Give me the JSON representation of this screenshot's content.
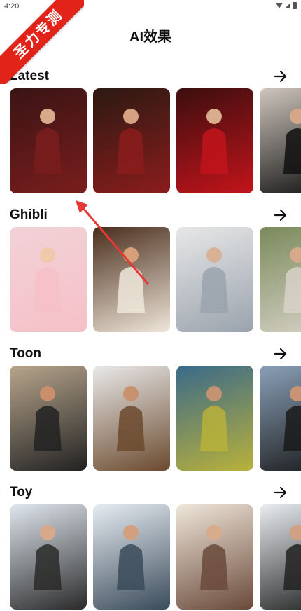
{
  "status": {
    "time": "4:20"
  },
  "badge": {
    "text": "圣力专测"
  },
  "page": {
    "title": "AI效果"
  },
  "sections": [
    {
      "label": "Latest",
      "cards": [
        {
          "bg": "#3a1414",
          "accent": "#7a1d1d",
          "skin": "#d8a98a"
        },
        {
          "bg": "#2c1a12",
          "accent": "#8b1c1c",
          "skin": "#d4a283"
        },
        {
          "bg": "#3c0e0e",
          "accent": "#c2141b",
          "skin": "#d9ae8e"
        },
        {
          "bg": "#cfc6bd",
          "accent": "#111111",
          "skin": "#d6a688"
        }
      ]
    },
    {
      "label": "Ghibli",
      "cards": [
        {
          "bg": "#f1d2d6",
          "accent": "#f6c0c8",
          "skin": "#f0c8aa"
        },
        {
          "bg": "#4a2e1c",
          "accent": "#efe6da",
          "skin": "#d7a07a"
        },
        {
          "bg": "#e7e7e7",
          "accent": "#9aa3ad",
          "skin": "#d9b197"
        },
        {
          "bg": "#7a8a5a",
          "accent": "#d7d2c8",
          "skin": "#d8a88a"
        }
      ]
    },
    {
      "label": "Toon",
      "cards": [
        {
          "bg": "#b7a58c",
          "accent": "#222222",
          "skin": "#c98e6a"
        },
        {
          "bg": "#e9e9e9",
          "accent": "#6b4a2e",
          "skin": "#c8926e"
        },
        {
          "bg": "#3a6a8a",
          "accent": "#b9b13a",
          "skin": "#c69372"
        },
        {
          "bg": "#8aa0b8",
          "accent": "#1a1a1a",
          "skin": "#c89474"
        }
      ]
    },
    {
      "label": "Toy",
      "cards": [
        {
          "bg": "#dfe6ee",
          "accent": "#2a2a2a",
          "skin": "#d7a88a"
        },
        {
          "bg": "#e6ecf2",
          "accent": "#3b4b5a",
          "skin": "#d2a07f"
        },
        {
          "bg": "#efe6da",
          "accent": "#6a4a3a",
          "skin": "#d8ab8b"
        },
        {
          "bg": "#e9ecf0",
          "accent": "#222222",
          "skin": "#d1a083"
        }
      ]
    }
  ],
  "icons": {
    "section_arrow": "arrow-right-icon"
  },
  "colors": {
    "badge": "#e2231a",
    "annotation": "#e53935"
  }
}
